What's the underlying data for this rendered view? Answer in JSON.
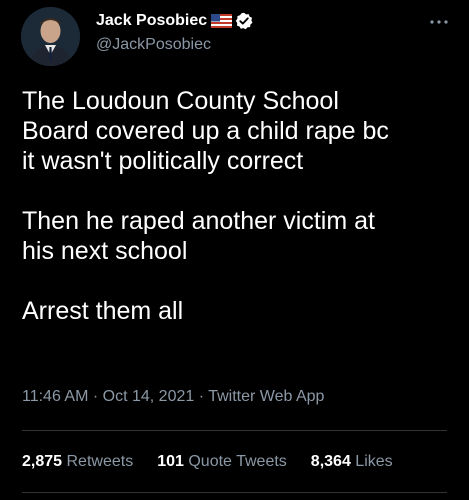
{
  "author": {
    "name": "Jack Posobiec",
    "handle": "@JackPosobiec",
    "flag_icon": "us-flag-icon",
    "verified_icon": "verified-badge-icon"
  },
  "tweet": {
    "paragraphs": [
      "The Loudoun County School\nBoard covered up a child rape bc\nit wasn't politically correct",
      "Then he raped another victim at\nhis next school",
      "Arrest them all"
    ],
    "time": "11:46 AM",
    "separator1": " · ",
    "date": "Oct 14, 2021",
    "separator2": " · ",
    "source": "Twitter Web App"
  },
  "stats": {
    "retweets_count": "2,875",
    "retweets_label": "Retweets",
    "quote_count": "101",
    "quote_label": "Quote Tweets",
    "likes_count": "8,364",
    "likes_label": "Likes"
  },
  "colors": {
    "background": "#000000",
    "text": "#ffffff",
    "secondary": "#8b98a5",
    "verified": "#ffffff",
    "divider": "#2f3336"
  },
  "icons": {
    "more": "more-horizontal-icon"
  }
}
